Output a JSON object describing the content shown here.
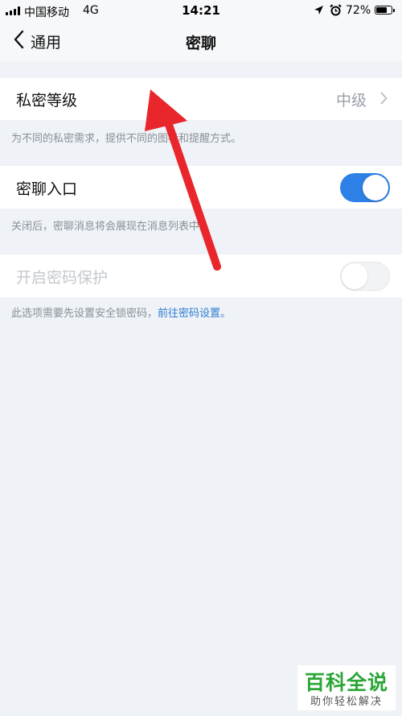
{
  "status_bar": {
    "carrier": "中国移动",
    "network": "4G",
    "time": "14:21",
    "battery": "72%"
  },
  "nav": {
    "back_label": "通用",
    "title": "密聊"
  },
  "settings": {
    "privacy_level": {
      "label": "私密等级",
      "value": "中级",
      "hint": "为不同的私密需求，提供不同的图标和提醒方式。"
    },
    "chat_entrance": {
      "label": "密聊入口",
      "enabled": true,
      "hint": "关闭后，密聊消息将会展现在消息列表中。"
    },
    "password_protection": {
      "label": "开启密码保护",
      "enabled": false,
      "hint_text": "此选项需要先设置安全锁密码，",
      "hint_link": "前往密码设置。"
    }
  },
  "watermark": {
    "title": "百科全说",
    "subtitle": "助你轻松解决"
  },
  "colors": {
    "accent": "#2d80e6",
    "annotation_arrow": "#e8262c",
    "watermark_green": "#2aa636",
    "background": "#eff2f6"
  }
}
